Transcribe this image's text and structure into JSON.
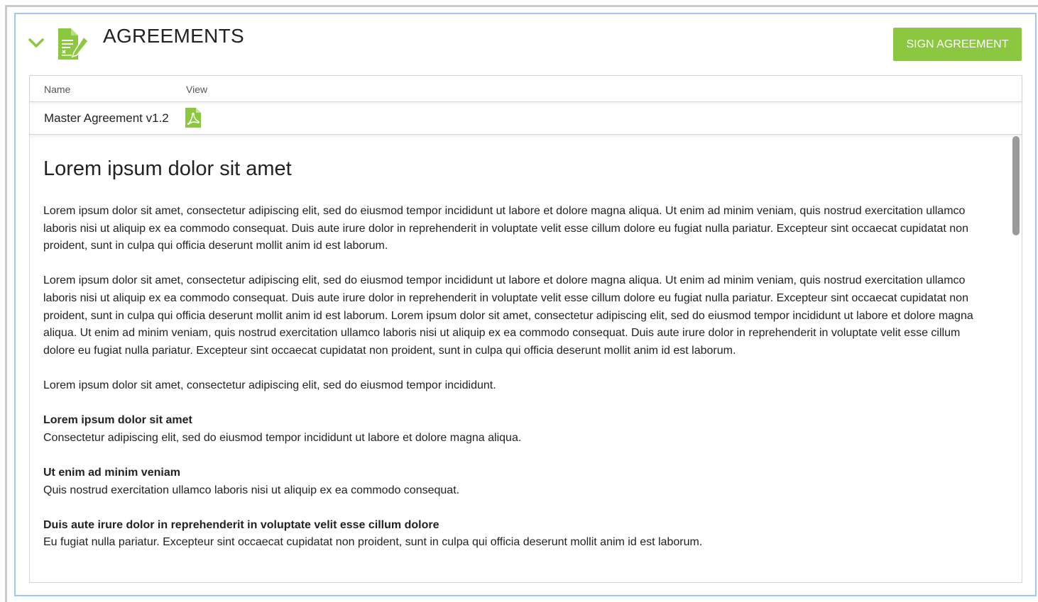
{
  "panel": {
    "title": "AGREEMENTS",
    "sign_button_label": "SIGN AGREEMENT",
    "accent_color": "#8bc83f"
  },
  "table": {
    "columns": [
      "Name",
      "View"
    ],
    "rows": [
      {
        "name": "Master Agreement v1.2",
        "view_icon": "pdf-icon"
      }
    ]
  },
  "document": {
    "heading": "Lorem ipsum dolor sit amet",
    "paragraphs": [
      "Lorem ipsum dolor sit amet, consectetur adipiscing elit, sed do eiusmod tempor incididunt ut labore et dolore magna aliqua. Ut enim ad minim veniam, quis nostrud exercitation ullamco laboris nisi ut aliquip ex ea commodo consequat. Duis aute irure dolor in reprehenderit in voluptate velit esse cillum dolore eu fugiat nulla pariatur. Excepteur sint occaecat cupidatat non proident, sunt in culpa qui officia deserunt mollit anim id est laborum.",
      "Lorem ipsum dolor sit amet, consectetur adipiscing elit, sed do eiusmod tempor incididunt ut labore et dolore magna aliqua. Ut enim ad minim veniam, quis nostrud exercitation ullamco laboris nisi ut aliquip ex ea commodo consequat. Duis aute irure dolor in reprehenderit in voluptate velit esse cillum dolore eu fugiat nulla pariatur. Excepteur sint occaecat cupidatat non proident, sunt in culpa qui officia deserunt mollit anim id est laborum. Lorem ipsum dolor sit amet, consectetur adipiscing elit, sed do eiusmod tempor incididunt ut labore et dolore magna aliqua. Ut enim ad minim veniam, quis nostrud exercitation ullamco laboris nisi ut aliquip ex ea commodo consequat. Duis aute irure dolor in reprehenderit in voluptate velit esse cillum dolore eu fugiat nulla pariatur. Excepteur sint occaecat cupidatat non proident, sunt in culpa qui officia deserunt mollit anim id est laborum.",
      "Lorem ipsum dolor sit amet, consectetur adipiscing elit, sed do eiusmod tempor incididunt."
    ],
    "sections": [
      {
        "title": "Lorem ipsum dolor sit amet",
        "body": "Consectetur adipiscing elit, sed do eiusmod tempor incididunt ut labore et dolore magna aliqua."
      },
      {
        "title": "Ut enim ad minim veniam",
        "body": "Quis nostrud exercitation ullamco laboris nisi ut aliquip ex ea commodo consequat."
      },
      {
        "title": "Duis aute irure dolor in reprehenderit in voluptate velit esse cillum dolore",
        "body": "Eu fugiat nulla pariatur. Excepteur sint occaecat cupidatat non proident, sunt in culpa qui officia deserunt mollit anim id est laborum."
      }
    ]
  }
}
